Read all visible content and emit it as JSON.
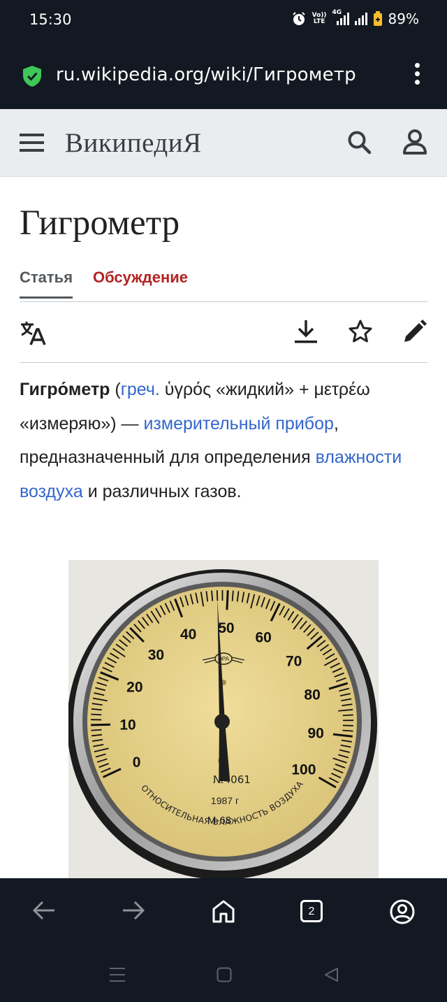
{
  "status_bar": {
    "time": "15:30",
    "volte_top": "Vo))",
    "volte_bottom": "LTE",
    "network": "4G",
    "battery": "89%",
    "icons": [
      "alarm-icon",
      "volte-icon",
      "signal-icon",
      "battery-icon"
    ]
  },
  "browser": {
    "url": "ru.wikipedia.org/wiki/Гигрометр",
    "secure_icon": "shield-check-icon",
    "menu_icon": "more-vertical-icon"
  },
  "wiki_header": {
    "logo": "ВикипедиЯ",
    "menu_icon": "hamburger-icon",
    "search_icon": "search-icon",
    "user_icon": "user-icon"
  },
  "article": {
    "title": "Гигрометр",
    "tabs": [
      {
        "label": "Статья",
        "active": true
      },
      {
        "label": "Обсуждение",
        "active": false
      }
    ],
    "actions": [
      "language-icon",
      "download-icon",
      "star-icon",
      "edit-icon"
    ],
    "intro": {
      "term": "Гигро́метр",
      "open_paren": " (",
      "greek_link": "греч.",
      "etymology": " ὑγρός «жидкий» + μετρέω «измеряю») — ",
      "link_device": "измерительный прибор",
      "mid_text": ", предназначенный для определения ",
      "link_humidity": "влажности воздуха",
      "end_text": " и различных газов."
    },
    "image": {
      "scale_labels": [
        "0",
        "10",
        "20",
        "30",
        "40",
        "50",
        "60",
        "70",
        "80",
        "90",
        "100"
      ],
      "dial_value": 48,
      "maker_mark": "ЭРА",
      "serial": "№4061",
      "year": "1987 г",
      "model": "М-68",
      "caption_arc": "ОТНОСИТЕЛЬНАЯ ВЛАЖНОСТЬ ВОЗДУХА %"
    }
  },
  "bottom_nav": {
    "tabs_count": "2",
    "items": [
      "back-icon",
      "forward-icon",
      "home-icon",
      "tabs-icon",
      "account-icon"
    ],
    "system": [
      "recent-apps-icon",
      "home-button-icon",
      "system-back-icon"
    ]
  },
  "colors": {
    "browser_bg": "#131922",
    "link": "#3366cc",
    "talk_tab": "#b32424",
    "header_bg": "#eaecf0",
    "shield": "#3ec85a",
    "dial_face": "#e8d48a"
  }
}
